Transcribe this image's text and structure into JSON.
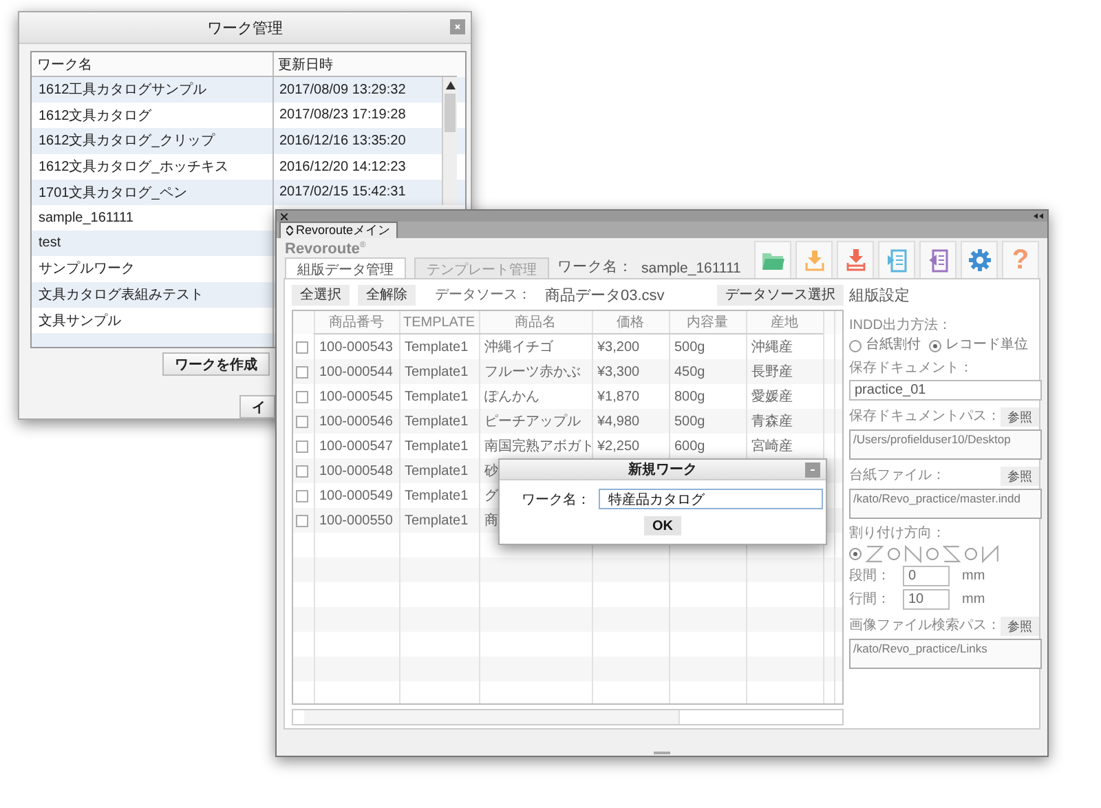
{
  "work_window": {
    "title": "ワーク管理",
    "columns": [
      "ワーク名",
      "更新日時"
    ],
    "rows": [
      {
        "name": "1612工具カタログサンプル",
        "updated": "2017/08/09 13:29:32"
      },
      {
        "name": "1612文具カタログ",
        "updated": "2017/08/23 17:19:28"
      },
      {
        "name": "1612文具カタログ_クリップ",
        "updated": "2016/12/16 13:35:20"
      },
      {
        "name": "1612文具カタログ_ホッチキス",
        "updated": "2016/12/20 14:12:23"
      },
      {
        "name": "1701文具カタログ_ペン",
        "updated": "2017/02/15 15:42:31"
      },
      {
        "name": "sample_161111"
      },
      {
        "name": "test"
      },
      {
        "name": "サンプルワーク"
      },
      {
        "name": "文具カタログ表組みテスト"
      },
      {
        "name": "文具サンプル"
      }
    ],
    "buttons": [
      "ワークを作成",
      "イ"
    ]
  },
  "main_window": {
    "tab": "Revorouteメイン",
    "brand": "Revoroute$^{®}$",
    "toolbar": [
      {
        "kind": "folder"
      },
      {
        "kind": "download"
      },
      {
        "kind": "download-tray"
      },
      {
        "kind": "import"
      },
      {
        "kind": "export"
      },
      {
        "kind": "settings"
      },
      {
        "kind": "help",
        "label": "?"
      }
    ],
    "tabs": [
      {
        "label": "組版データ管理",
        "selected": true,
        "disabled": false
      },
      {
        "label": "テンプレート管理",
        "selected": false,
        "disabled": true
      }
    ],
    "work_name_label": "ワーク名：",
    "work_name": "sample_161111",
    "select_all": "全選択",
    "deselect_all": "全解除",
    "datasource_label": "データソース：",
    "datasource": "商品データ03.csv",
    "datasource_button": "データソース選択",
    "table": {
      "columns": [
        "商品番号",
        "TEMPLATE",
        "商品名",
        "価格",
        "内容量",
        "産地"
      ],
      "rows": [
        {
          "checked": false,
          "cells": [
            "100-000543",
            "Template1",
            "沖縄イチゴ",
            "¥3,200",
            "500g",
            "沖縄産"
          ]
        },
        {
          "checked": false,
          "cells": [
            "100-000544",
            "Template1",
            "フルーツ赤かぶ",
            "¥3,300",
            "450g",
            "長野産"
          ]
        },
        {
          "checked": false,
          "cells": [
            "100-000545",
            "Template1",
            "ぽんかん",
            "¥1,870",
            "800g",
            "愛媛産"
          ]
        },
        {
          "checked": false,
          "cells": [
            "100-000546",
            "Template1",
            "ピーチアップル",
            "¥4,980",
            "500g",
            "青森産"
          ]
        },
        {
          "checked": false,
          "cells": [
            "100-000547",
            "Template1",
            "南国完熟アボガト",
            "¥2,250",
            "600g",
            "宮崎産"
          ]
        },
        {
          "checked": false,
          "cells": [
            "100-000548",
            "Template1",
            "砂"
          ]
        },
        {
          "checked": false,
          "cells": [
            "100-000549",
            "Template1",
            "グ"
          ]
        },
        {
          "checked": false,
          "cells": [
            "100-000550",
            "Template1",
            "商"
          ]
        }
      ]
    },
    "settings": {
      "title": "組版設定",
      "output_label": "INDD出力方法：",
      "output_options": [
        {
          "label": "台紙割付",
          "selected": false
        },
        {
          "label": "レコード単位",
          "selected": true
        }
      ],
      "doc_label": "保存ドキュメント：",
      "doc_value": "practice_01",
      "doc_path_label": "保存ドキュメントパス：",
      "doc_path": "/Users/profielduser10/Desktop",
      "doc_path_button": "参照",
      "master_label": "台紙ファイル：",
      "master_path": "/kato/Revo_practice/master.indd",
      "master_button": "参照",
      "direction_label": "割り付け方向：",
      "directions": [
        {
          "kind": "z",
          "selected": true
        },
        {
          "kind": "n",
          "selected": false
        },
        {
          "kind": "reverse-z",
          "selected": false
        },
        {
          "kind": "reverse-n",
          "selected": false
        }
      ],
      "column_gap_label": "段間：",
      "column_gap": "0",
      "column_gap_unit": "mm",
      "line_gap_label": "行間：",
      "line_gap": "10",
      "line_gap_unit": "mm",
      "image_label": "画像ファイル検索パス：",
      "image_path": "/kato/Revo_practice/Links",
      "image_button": "参照"
    }
  },
  "dialog": {
    "title": "新規ワーク",
    "label": "ワーク名：",
    "value": "特産品カタログ",
    "button": "OK"
  }
}
